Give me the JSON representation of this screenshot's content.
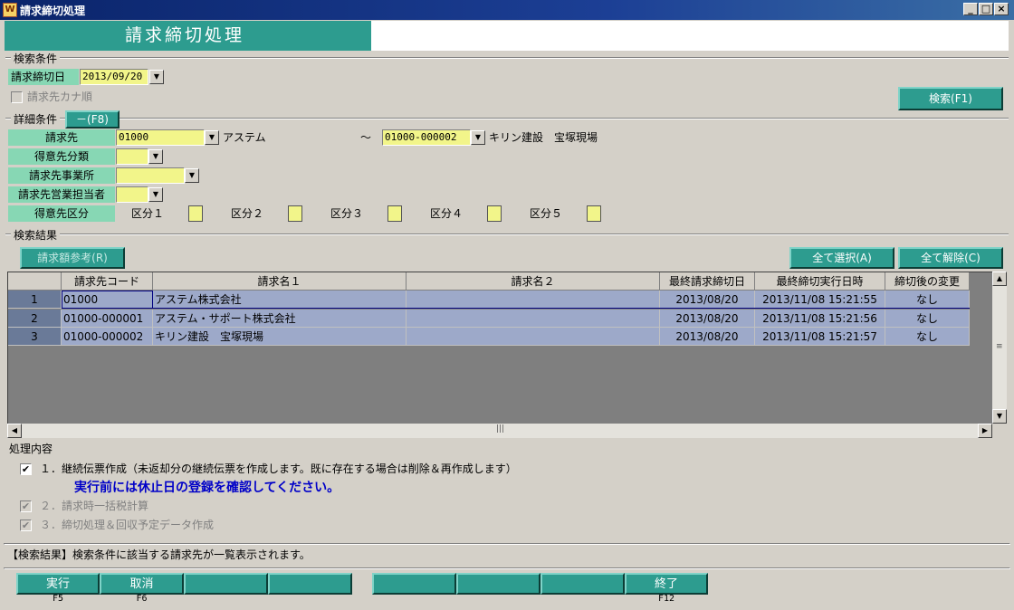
{
  "window": {
    "title": "請求締切処理",
    "icon_text": "W"
  },
  "header": {
    "title": "請求締切処理"
  },
  "search": {
    "section_label": "検索条件",
    "close_date_label": "請求締切日",
    "close_date_value": "2013/09/20",
    "kana_order_label": "請求先カナ順",
    "search_button": "検索(F1)"
  },
  "detail": {
    "section_label": "詳細条件",
    "toggle_button": "－(F8)",
    "customer_label": "請求先",
    "customer_from_code": "01000",
    "customer_from_name": "アステム",
    "range_sep": "～",
    "customer_to_code": "01000-000002",
    "customer_to_name": "キリン建設　宝塚現場",
    "category_label": "得意先分類",
    "office_label": "請求先事業所",
    "staff_label": "請求先営業担当者",
    "division_label": "得意先区分",
    "divisions": [
      "区分１",
      "区分２",
      "区分３",
      "区分４",
      "区分５"
    ]
  },
  "results": {
    "section_label": "検索結果",
    "ref_button": "請求額参考(R)",
    "select_all_button": "全て選択(A)",
    "clear_all_button": "全て解除(C)",
    "columns": [
      "請求先コード",
      "請求名１",
      "請求名２",
      "最終請求締切日",
      "最終締切実行日時",
      "締切後の変更"
    ],
    "rows": [
      {
        "no": "1",
        "code": "01000",
        "name1": "アステム株式会社",
        "name2": "",
        "last_close": "2013/08/20",
        "last_exec": "2013/11/08 15:21:55",
        "changed": "なし"
      },
      {
        "no": "2",
        "code": "01000-000001",
        "name1": "アステム・サポート株式会社",
        "name2": "",
        "last_close": "2013/08/20",
        "last_exec": "2013/11/08 15:21:56",
        "changed": "なし"
      },
      {
        "no": "3",
        "code": "01000-000002",
        "name1": "キリン建設　宝塚現場",
        "name2": "",
        "last_close": "2013/08/20",
        "last_exec": "2013/11/08 15:21:57",
        "changed": "なし"
      }
    ]
  },
  "process": {
    "section_label": "処理内容",
    "item1": "１．継続伝票作成（未返却分の継続伝票を作成します。既に存在する場合は削除＆再作成します）",
    "warning": "実行前には休止日の登録を確認してください。",
    "item2": "２．請求時一括税計算",
    "item3": "３．締切処理＆回収予定データ作成"
  },
  "status": {
    "message": "【検索結果】検索条件に該当する請求先が一覧表示されます。"
  },
  "fkeys": {
    "exec_label": "実行",
    "exec_key": "F5",
    "cancel_label": "取消",
    "cancel_key": "F6",
    "end_label": "終了",
    "end_key": "F12"
  },
  "colors": {
    "teal": "#2d9c8f",
    "green_label": "#87d7b4",
    "yellow_field": "#f2f58a",
    "row_bg": "#9da9c9",
    "warning_text": "#0000c8"
  }
}
